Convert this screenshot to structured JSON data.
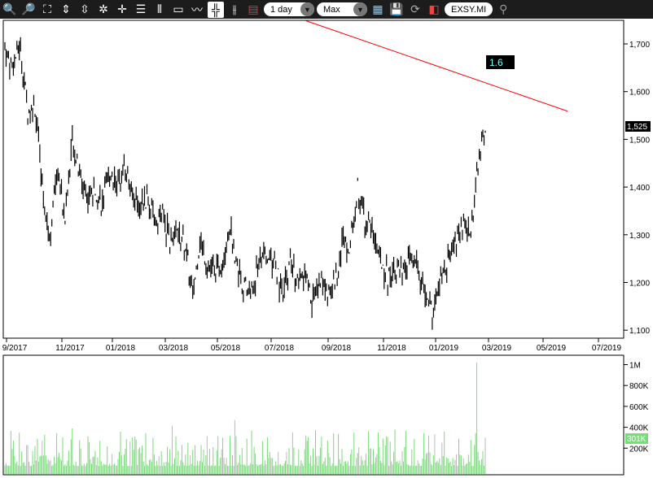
{
  "toolbar": {
    "icons": [
      "zoom-in-horizontal-icon",
      "zoom-out-horizontal-icon",
      "fit-icon",
      "zoom-in-vertical-icon",
      "zoom-out-vertical-icon",
      "reset-zoom-icon",
      "crosshair-icon",
      "horizontal-grid-icon",
      "vertical-grid-icon",
      "window-icon",
      "line-chart-icon",
      "candlestick-icon",
      "ohlc-bar-icon",
      "indicator-list-icon"
    ],
    "interval": "1 day",
    "range": "Max",
    "symbol": "EXSY.MI"
  },
  "chart_data": {
    "type": "line",
    "price_panel": {
      "yticks": [
        "1,700",
        "1,600",
        "1,500",
        "1,400",
        "1,300",
        "1,200",
        "1,100"
      ],
      "ytick_values": [
        1700,
        1600,
        1500,
        1400,
        1300,
        1200,
        1100
      ],
      "ylim": [
        1050,
        1750
      ],
      "xticks": [
        "9/2017",
        "11/2017",
        "01/2018",
        "03/2018",
        "05/2018",
        "07/2018",
        "09/2018",
        "11/2018",
        "01/2019",
        "03/2019",
        "05/2019",
        "07/2019"
      ],
      "last_price_label": "1,525",
      "series_keypoints": [
        1690,
        1650,
        1700,
        1560,
        1570,
        1400,
        1290,
        1450,
        1330,
        1500,
        1420,
        1380,
        1400,
        1360,
        1430,
        1410,
        1450,
        1380,
        1360,
        1370,
        1330,
        1340,
        1290,
        1300,
        1280,
        1170,
        1290,
        1240,
        1220,
        1240,
        1320,
        1230,
        1190,
        1180,
        1260,
        1250,
        1240,
        1170,
        1240,
        1200,
        1210,
        1160,
        1210,
        1180,
        1200,
        1290,
        1280,
        1400,
        1330,
        1310,
        1250,
        1210,
        1240,
        1210,
        1250,
        1230,
        1170,
        1140,
        1200,
        1240,
        1280,
        1320,
        1300,
        1440,
        1525
      ],
      "trendline": {
        "label": "1.6",
        "start_price": 1749,
        "end_price": 1559,
        "color": "#ff0000"
      }
    },
    "volume_panel": {
      "yticks": [
        "1M",
        "800K",
        "600K",
        "400K",
        "200K"
      ],
      "ytick_values": [
        1000000,
        800000,
        600000,
        400000,
        200000
      ],
      "last_volume_label": "301K",
      "bar_color": "#77dd77"
    }
  }
}
